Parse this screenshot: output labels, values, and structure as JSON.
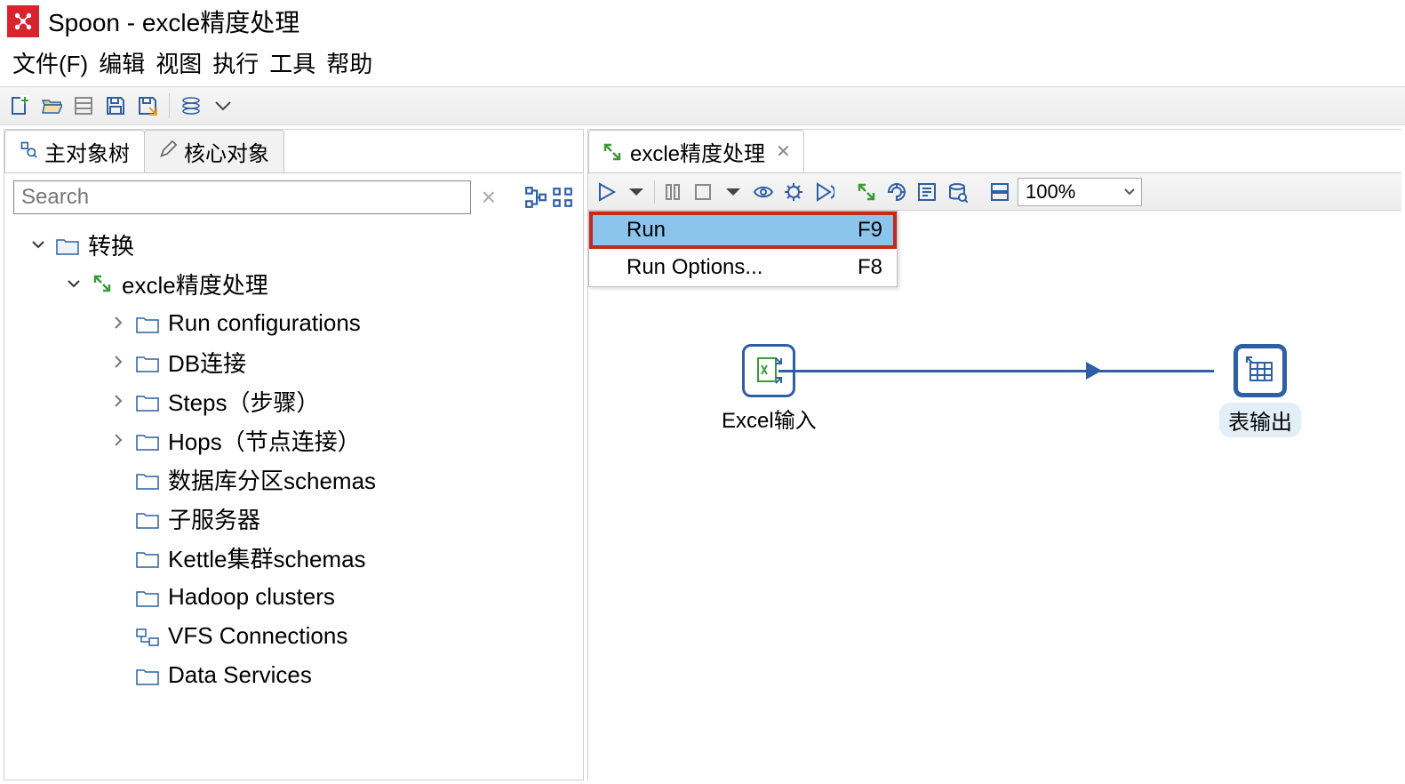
{
  "title": "Spoon - excle精度处理",
  "menubar": {
    "file": "文件(F)",
    "edit": "编辑",
    "view": "视图",
    "action": "执行",
    "tools": "工具",
    "help": "帮助"
  },
  "left": {
    "tab_main": "主对象树",
    "tab_core": "核心对象",
    "search_placeholder": "Search",
    "tree": {
      "root": "转换",
      "transformation": "excle精度处理",
      "items": {
        "run_conf": "Run configurations",
        "db": "DB连接",
        "steps": "Steps（步骤）",
        "hops": "Hops（节点连接）",
        "schemas": "数据库分区schemas",
        "slaves": "子服务器",
        "kettle": "Kettle集群schemas",
        "hadoop": "Hadoop clusters",
        "vfs": "VFS Connections",
        "ds": "Data Services"
      }
    }
  },
  "right": {
    "tab_label": "excle精度处理",
    "zoom": "100%",
    "run_menu": {
      "run": "Run",
      "run_key": "F9",
      "options": "Run Options...",
      "options_key": "F8"
    },
    "nodes": {
      "excel_in": "Excel输入",
      "table_out": "表输出"
    }
  }
}
